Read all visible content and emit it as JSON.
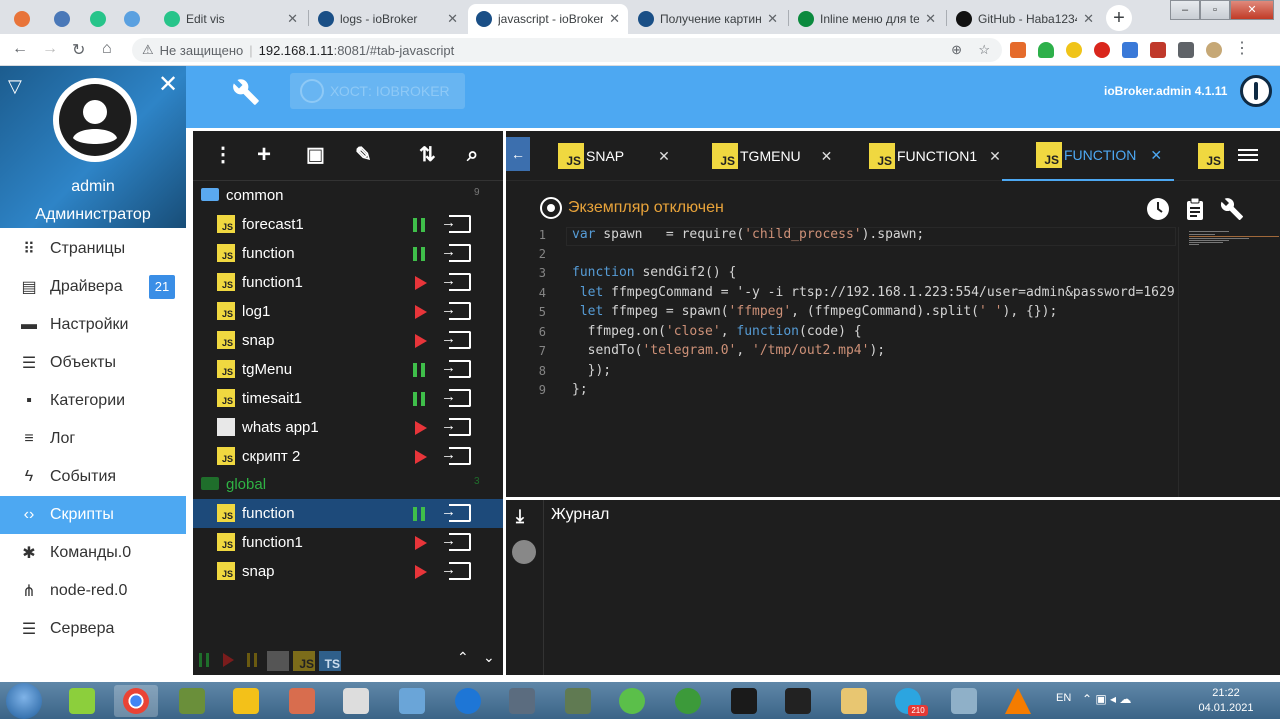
{
  "browser": {
    "tabs": [
      {
        "title": "",
        "fav": "#e8743a"
      },
      {
        "title": "",
        "fav": "#4a78b8"
      },
      {
        "title": "",
        "fav": "#27c48a"
      },
      {
        "title": "",
        "fav": "#5aa0e0"
      },
      {
        "title": "Edit vis",
        "fav": "#27c48a"
      },
      {
        "title": "logs - ioBroker",
        "fav": "#1a4f86"
      },
      {
        "title": "javascript - ioBroker",
        "fav": "#1a4f86"
      },
      {
        "title": "Получение картин",
        "fav": "#1a4f86"
      },
      {
        "title": "Inline меню для tel",
        "fav": "#0b8a3e"
      },
      {
        "title": "GitHub - Haba1234",
        "fav": "#111111"
      }
    ],
    "address_warning": "Не защищено",
    "url_host": "192.168.1.11",
    "url_path": ":8081/#tab-javascript"
  },
  "header": {
    "host_label": "ХОСТ: IOBROKER",
    "admin_version": "ioBroker.admin 4.1.11"
  },
  "user": {
    "name": "admin",
    "role": "Администратор"
  },
  "menu": [
    {
      "label": "Страницы",
      "icon": "grid-icon"
    },
    {
      "label": "Драйвера",
      "icon": "store-icon",
      "badge": "21"
    },
    {
      "label": "Настройки",
      "icon": "settings-icon"
    },
    {
      "label": "Объекты",
      "icon": "list-icon"
    },
    {
      "label": "Категории",
      "icon": "category-icon"
    },
    {
      "label": "Лог",
      "icon": "log-icon"
    },
    {
      "label": "События",
      "icon": "bolt-icon"
    },
    {
      "label": "Скрипты",
      "icon": "code-icon",
      "active": true
    },
    {
      "label": "Команды.0",
      "icon": "snowflake-icon"
    },
    {
      "label": "node-red.0",
      "icon": "nodes-icon"
    },
    {
      "label": "Сервера",
      "icon": "server-icon"
    }
  ],
  "tree": {
    "folders": [
      {
        "label": "common",
        "count": "9"
      },
      {
        "label": "global",
        "count": "3"
      }
    ],
    "scripts": [
      {
        "label": "forecast1",
        "state": "running",
        "type": "js"
      },
      {
        "label": "function",
        "state": "running",
        "type": "js"
      },
      {
        "label": "function1",
        "state": "stopped",
        "type": "js"
      },
      {
        "label": "log1",
        "state": "stopped",
        "type": "js"
      },
      {
        "label": "snap",
        "state": "stopped",
        "type": "js"
      },
      {
        "label": "tgMenu",
        "state": "running",
        "type": "js"
      },
      {
        "label": "timesait1",
        "state": "running",
        "type": "js"
      },
      {
        "label": "whats app1",
        "state": "stopped",
        "type": "blockly"
      },
      {
        "label": "скрипт 2",
        "state": "stopped",
        "type": "js"
      },
      {
        "label": "function",
        "state": "running",
        "type": "js",
        "selected": true
      },
      {
        "label": "function1",
        "state": "stopped",
        "type": "js"
      },
      {
        "label": "snap",
        "state": "stopped",
        "type": "js"
      }
    ],
    "footer_labels": [
      "JS",
      "TS"
    ]
  },
  "editor": {
    "tabs": [
      {
        "label": "SNAP",
        "badge": "JS"
      },
      {
        "label": "TGMENU",
        "badge": "JS"
      },
      {
        "label": "FUNCTION1",
        "badge": "JS"
      },
      {
        "label": "FUNCTION",
        "badge": "JS",
        "active": true
      },
      {
        "label": "",
        "badge": "JS"
      }
    ],
    "instance_status": "Экземпляр отключен",
    "line_numbers": [
      "1",
      "2",
      "3",
      "4",
      "5",
      "6",
      "7",
      "8",
      "9"
    ],
    "code_lines": [
      "var spawn   = require('child_process').spawn;",
      "",
      "function sendGif2() {",
      " let ffmpegCommand = '-y -i rtsp://192.168.1.223:554/user=admin&password=1629",
      " let ffmpeg = spawn('ffmpeg', (ffmpegCommand).split(' '), {});",
      "  ffmpeg.on('close', function(code) {",
      "  sendTo('telegram.0', '/tmp/out2.mp4');",
      "  });",
      "};"
    ]
  },
  "log": {
    "title": "Журнал"
  },
  "taskbar": {
    "lang": "EN",
    "time": "21:22",
    "date": "04.01.2021",
    "telegram_badge": "210"
  }
}
